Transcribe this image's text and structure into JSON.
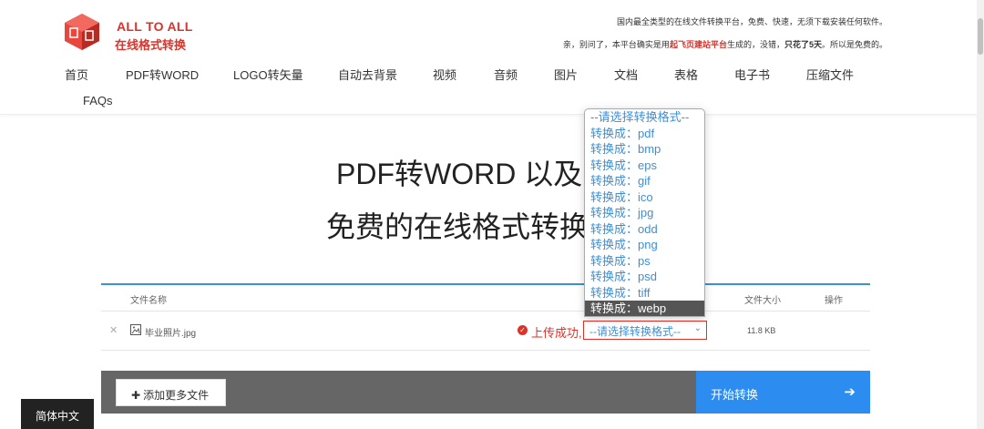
{
  "brand": {
    "name_en": "ALL TO ALL",
    "name_cn": "在线格式转换",
    "colors": {
      "accent": "#d9342b",
      "link": "#3d8fd6",
      "button": "#2d8cf0"
    }
  },
  "notice": {
    "line1": "国内最全类型的在线文件转换平台，免费、快速，无须下载安装任何软件。",
    "line2_a": "亲，别问了，本平台确实是用",
    "line2_red": "起飞页建站平台",
    "line2_b": "生成的，没错，",
    "line2_bold": "只花了5天",
    "line2_c": "。所以是免费的。"
  },
  "nav": {
    "items": [
      "首页",
      "PDF转WORD",
      "LOGO转矢量",
      "自动去背景",
      "视频",
      "音频",
      "图片",
      "文档",
      "表格",
      "电子书",
      "压缩文件",
      "FAQs"
    ]
  },
  "hero": {
    "line1": "PDF转WORD 以及更",
    "line2": "免费的在线格式转换"
  },
  "table": {
    "headers": {
      "filename": "文件名称",
      "size": "文件大小",
      "action": "操作"
    },
    "rows": [
      {
        "remove_icon": "close-icon",
        "file_icon": "image-icon",
        "filename": "毕业照片.jpg",
        "status_icon": "check-circle-icon",
        "status": "上传成功,",
        "format_select_value": "--请选择转换格式--",
        "size": "11.8 KB"
      }
    ]
  },
  "dropdown": {
    "options": [
      "--请选择转换格式--",
      "转换成：pdf",
      "转换成：bmp",
      "转换成：eps",
      "转换成：gif",
      "转换成：ico",
      "转换成：jpg",
      "转换成：odd",
      "转换成：png",
      "转换成：ps",
      "转换成：psd",
      "转换成：tiff",
      "转换成：webp"
    ],
    "highlighted": "转换成：webp"
  },
  "actions": {
    "add_files": "添加更多文件",
    "start_convert": "开始转换",
    "start_icon": "arrow-right-icon"
  },
  "language": "简体中文"
}
